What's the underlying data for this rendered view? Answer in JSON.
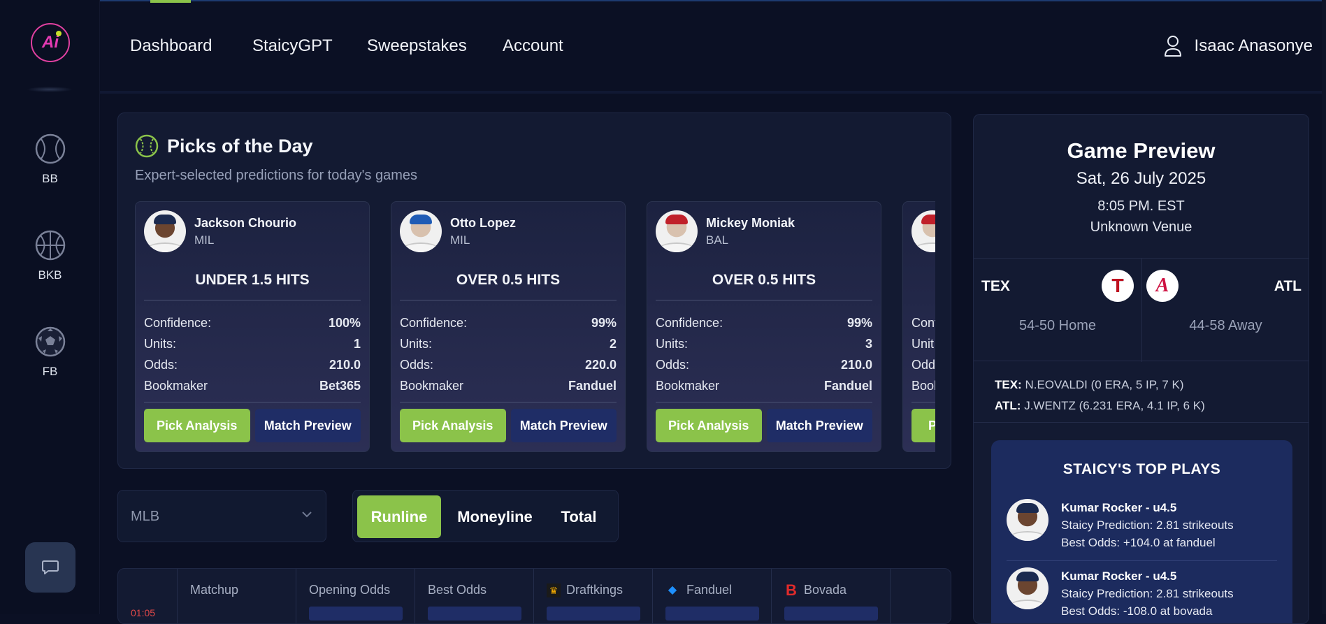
{
  "sidebar": {
    "logo_text": "Ai",
    "items": [
      {
        "label": "BB",
        "icon": "baseball-icon"
      },
      {
        "label": "BKB",
        "icon": "basketball-icon"
      },
      {
        "label": "FB",
        "icon": "soccer-ball-icon"
      }
    ],
    "chat_icon": "chat-icon"
  },
  "nav": {
    "items": [
      "Dashboard",
      "StaicyGPT",
      "Sweepstakes",
      "Account"
    ],
    "user_name": "Isaac Anasonye"
  },
  "picks": {
    "title": "Picks of the Day",
    "subtitle": "Expert-selected predictions for today's games",
    "labels": {
      "confidence": "Confidence:",
      "units": "Units:",
      "odds": "Odds:",
      "bookmaker": "Bookmaker"
    },
    "buttons": {
      "analysis": "Pick Analysis",
      "preview": "Match Preview"
    },
    "cards": [
      {
        "name": "Jackson Chourio",
        "team": "MIL",
        "pick": "UNDER 1.5 HITS",
        "confidence": "100%",
        "units": "1",
        "odds": "210.0",
        "bookmaker": "Bet365"
      },
      {
        "name": "Otto Lopez",
        "team": "MIL",
        "pick": "OVER 0.5 HITS",
        "confidence": "99%",
        "units": "2",
        "odds": "220.0",
        "bookmaker": "Fanduel"
      },
      {
        "name": "Mickey Moniak",
        "team": "BAL",
        "pick": "OVER 0.5 HITS",
        "confidence": "99%",
        "units": "3",
        "odds": "210.0",
        "bookmaker": "Fanduel"
      },
      {
        "name": "",
        "team": "",
        "pick": "",
        "confidence": "",
        "units": "",
        "odds": "",
        "bookmaker": "",
        "partial_labels": {
          "confidence": "Conf",
          "units": "Unit",
          "odds": "Odd",
          "bookmaker": "Book",
          "analysis": "P"
        }
      }
    ]
  },
  "filters": {
    "league": "MLB",
    "markets": [
      "Runline",
      "Moneyline",
      "Total"
    ],
    "active_market": "Runline"
  },
  "table": {
    "time": "01:05",
    "headers": [
      "Matchup",
      "Opening Odds",
      "Best Odds",
      "Draftkings",
      "Fanduel",
      "Bovada"
    ]
  },
  "preview": {
    "title": "Game Preview",
    "date": "Sat, 26 July 2025",
    "time": "8:05 PM. EST",
    "venue": "Unknown Venue",
    "home": {
      "abbr": "TEX",
      "record": "54-50 Home",
      "logo": "T"
    },
    "away": {
      "abbr": "ATL",
      "record": "44-58 Away",
      "logo": "A"
    },
    "pitchers": [
      {
        "team": "TEX:",
        "line": "N.EOVALDI (0 ERA, 5 IP, 7 K)"
      },
      {
        "team": "ATL:",
        "line": "J.WENTZ (6.231 ERA, 4.1 IP, 6 K)"
      }
    ],
    "top_plays": {
      "title": "STAICY'S TOP PLAYS",
      "plays": [
        {
          "name": "Kumar Rocker - u4.5",
          "prediction": "Staicy Prediction: 2.81 strikeouts",
          "odds_label": "Best Odds:",
          "odds": "+104.0 at fanduel"
        },
        {
          "name": "Kumar Rocker - u4.5",
          "prediction": "Staicy Prediction: 2.81 strikeouts",
          "odds_label": "Best Odds:",
          "odds": "-108.0 at bovada"
        }
      ]
    }
  },
  "colors": {
    "accent_green": "#8bc34a",
    "navy_button": "#1f2d66",
    "brand_pink": "#e33ab2",
    "background": "#0b1024"
  }
}
